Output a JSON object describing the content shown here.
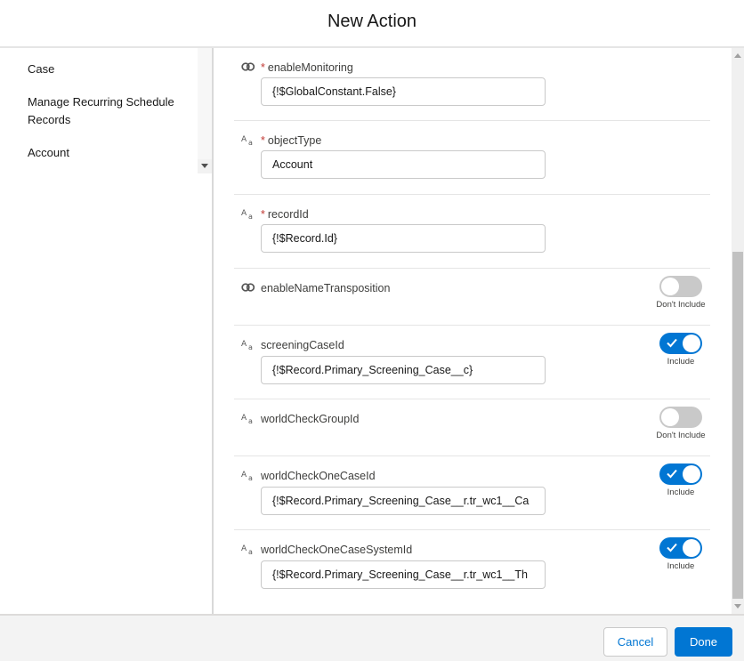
{
  "dialog": {
    "title": "New Action"
  },
  "sidebar": {
    "items": [
      {
        "label": "Case"
      },
      {
        "label": "Manage Recurring Schedule Records"
      },
      {
        "label": "Account"
      }
    ]
  },
  "parameters": [
    {
      "name": "enableMonitoring",
      "icon": "boolean-link-icon",
      "required": true,
      "value": "{!$GlobalConstant.False}"
    },
    {
      "name": "objectType",
      "icon": "text-type-icon",
      "required": true,
      "value": "Account"
    },
    {
      "name": "recordId",
      "icon": "text-type-icon",
      "required": true,
      "value": "{!$Record.Id}"
    },
    {
      "name": "enableNameTransposition",
      "icon": "boolean-link-icon",
      "required": false,
      "toggle": {
        "state": "off",
        "label": "Don't Include"
      }
    },
    {
      "name": "screeningCaseId",
      "icon": "text-type-icon",
      "required": false,
      "value": "{!$Record.Primary_Screening_Case__c}",
      "toggle": {
        "state": "on",
        "label": "Include"
      }
    },
    {
      "name": "worldCheckGroupId",
      "icon": "text-type-icon",
      "required": false,
      "toggle": {
        "state": "off",
        "label": "Don't Include"
      }
    },
    {
      "name": "worldCheckOneCaseId",
      "icon": "text-type-icon",
      "required": false,
      "value": "{!$Record.Primary_Screening_Case__r.tr_wc1__Ca",
      "toggle": {
        "state": "on",
        "label": "Include"
      }
    },
    {
      "name": "worldCheckOneCaseSystemId",
      "icon": "text-type-icon",
      "required": false,
      "value": "{!$Record.Primary_Screening_Case__r.tr_wc1__Th",
      "toggle": {
        "state": "on",
        "label": "Include"
      }
    }
  ],
  "required_marker": "*",
  "footer": {
    "cancel_label": "Cancel",
    "done_label": "Done"
  },
  "colors": {
    "brand": "#0176d3",
    "required": "#c23934",
    "toggle_off": "#c9c9c9"
  }
}
